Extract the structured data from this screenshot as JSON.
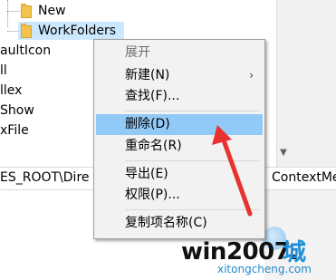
{
  "tree": {
    "items": [
      {
        "label": "New"
      },
      {
        "label": "WorkFolders"
      },
      {
        "label": "aultIcon"
      },
      {
        "label": "ll"
      },
      {
        "label": "llex"
      },
      {
        "label": "Show"
      },
      {
        "label": "xFile"
      }
    ]
  },
  "address": {
    "left_text": "ES_ROOT\\Dire",
    "right_text": "ContextMe"
  },
  "context_menu": {
    "items": [
      {
        "label": "展开",
        "header": true
      },
      {
        "label": "新建(N)",
        "has_submenu": true
      },
      {
        "label": "查找(F)..."
      },
      {
        "label": "删除(D)",
        "highlighted": true
      },
      {
        "label": "重命名(R)"
      },
      {
        "label": "导出(E)"
      },
      {
        "label": "权限(P)..."
      },
      {
        "label": "复制项名称(C)"
      }
    ],
    "submenu_arrow": "›"
  },
  "annotation": {
    "color": "#e8322f"
  },
  "watermark": {
    "main": "win2007.",
    "cn": "城",
    "sub": "xitongcheng.com"
  },
  "icons": {
    "folder": "folder-icon",
    "scroll_up": "scroll-down-arrow-icon"
  }
}
